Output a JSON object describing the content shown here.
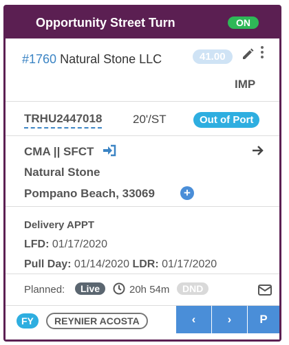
{
  "header": {
    "title": "Opportunity Street Turn",
    "status": "ON"
  },
  "order": {
    "number": "#1760",
    "customer": "Natural Stone LLC",
    "rate": "41.00",
    "type": "IMP"
  },
  "container": {
    "id": "TRHU2447018",
    "size": "20'/ST",
    "status": "Out of Port"
  },
  "route": {
    "carrier": "CMA || SFCT",
    "location_name": "Natural Stone",
    "location_city": "Pompano Beach, 33069"
  },
  "dates": {
    "appointment": "Delivery APPT",
    "lfd_label": "LFD:",
    "lfd_value": "01/17/2020",
    "pull_label": "Pull Day:",
    "pull_value": "01/14/2020",
    "ldr_label": "LDR:",
    "ldr_value": "01/17/2020"
  },
  "status_row": {
    "planned_label": "Planned:",
    "live": "Live",
    "timer": "20h 54m",
    "dnd": "DND"
  },
  "footer": {
    "fy": "FY",
    "user": "REYNIER ACOSTA",
    "prev": "‹",
    "next": "›",
    "p": "P"
  },
  "colors": {
    "header": "#5b1f52",
    "on": "#2eb857",
    "link": "#3b84c4",
    "pill_blue": "#2eaee0",
    "nav_blue": "#4a8ed8"
  }
}
